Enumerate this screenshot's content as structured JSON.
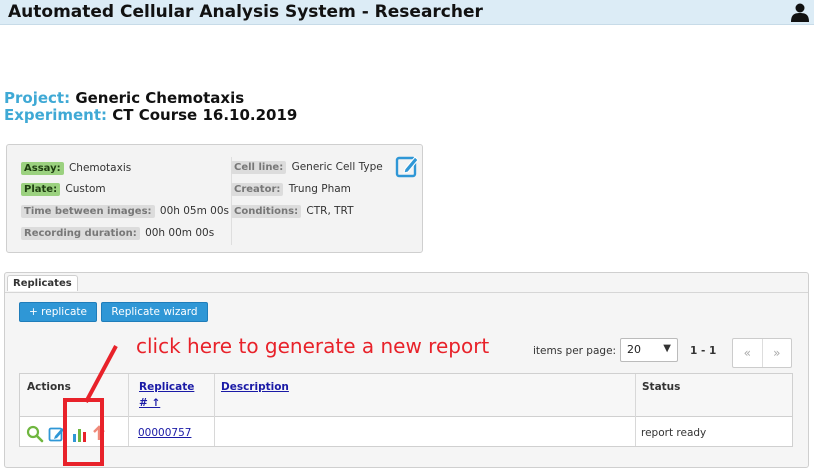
{
  "header": {
    "title": "Automated Cellular Analysis System - Researcher"
  },
  "project": {
    "project_label": "Project:",
    "project_value": "Generic Chemotaxis",
    "experiment_label": "Experiment:",
    "experiment_value": "CT Course 16.10.2019"
  },
  "info": {
    "assay_label": "Assay:",
    "assay_value": "Chemotaxis",
    "plate_label": "Plate:",
    "plate_value": "Custom",
    "time_between_label": "Time between images:",
    "time_between_value": "00h 05m 00s",
    "recording_label": "Recording duration:",
    "recording_value": "00h 00m 00s",
    "cell_line_label": "Cell line:",
    "cell_line_value": "Generic Cell Type",
    "creator_label": "Creator:",
    "creator_value": "Trung Pham",
    "conditions_label": "Conditions:",
    "conditions_value": "CTR, TRT"
  },
  "replicates": {
    "tab_label": "Replicates",
    "add_button": "+ replicate",
    "wizard_button": "Replicate wizard",
    "items_per_page_label": "items per page:",
    "items_per_page_value": "20",
    "range": "1 - 1",
    "pager_first": "«",
    "pager_prev": "»",
    "columns": {
      "actions": "Actions",
      "replicate_line1": "Replicate",
      "replicate_line2": "# ↑",
      "description": "Description",
      "status": "Status"
    },
    "rows": [
      {
        "replicate": "00000757",
        "description": "",
        "status": "report ready"
      }
    ]
  },
  "annotation": {
    "text": "click here to generate a new report",
    "color": "#e8222a"
  },
  "colors": {
    "header_bg": "#dcecf6",
    "label_blue": "#3fa9d5",
    "button_blue": "#2f97d6",
    "tag_green": "#9bd17f"
  }
}
